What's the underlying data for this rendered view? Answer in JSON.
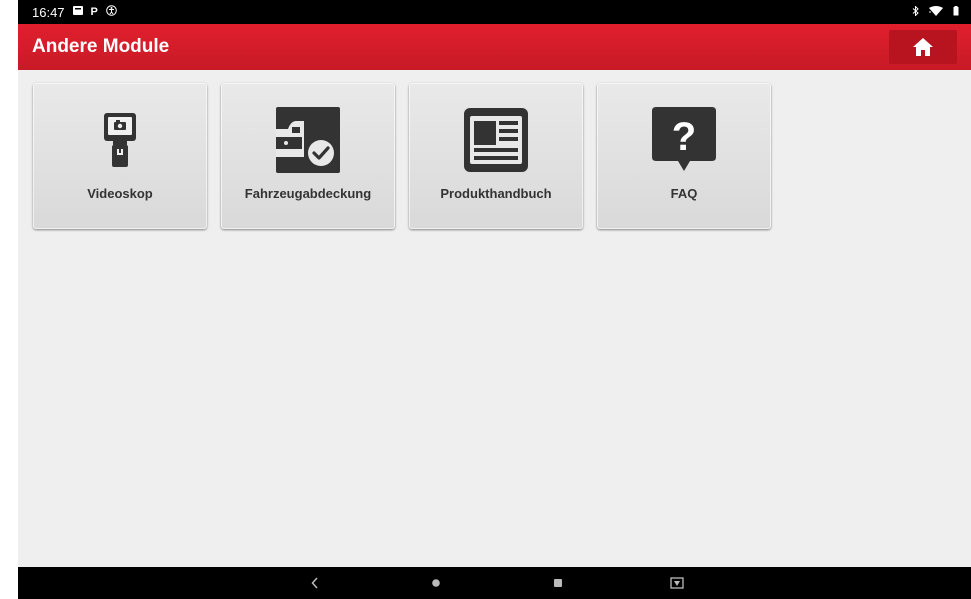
{
  "status_bar": {
    "time": "16:47",
    "left_icons": [
      "notification-icon",
      "parking-icon",
      "accessibility-icon"
    ],
    "right_icons": [
      "bluetooth-icon",
      "wifi-icon",
      "battery-icon"
    ]
  },
  "app_bar": {
    "title": "Andere Module",
    "home_icon": "home-icon",
    "color": "#d71f2b"
  },
  "modules": [
    {
      "label": "Videoskop",
      "icon": "videoscope-icon"
    },
    {
      "label": "Fahrzeugabdeckung",
      "icon": "vehicle-coverage-icon"
    },
    {
      "label": "Produkthandbuch",
      "icon": "manual-icon"
    },
    {
      "label": "FAQ",
      "icon": "faq-icon"
    }
  ],
  "nav_bar": {
    "buttons": [
      "back-icon",
      "home-circle-icon",
      "recents-icon",
      "screenshot-icon"
    ]
  }
}
